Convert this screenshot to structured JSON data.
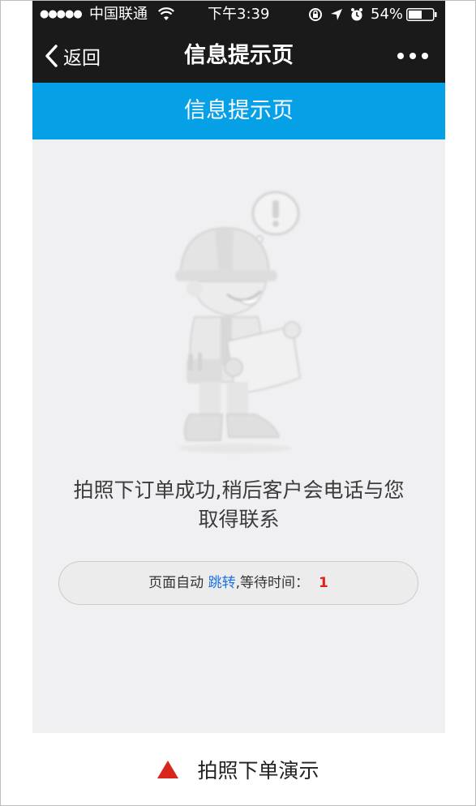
{
  "status_bar": {
    "signal": "●●●●●",
    "carrier": "中国联通",
    "time": "下午3:39",
    "battery": "54%",
    "icons": [
      "signal-dots-icon",
      "wifi-icon",
      "orientation-lock-icon",
      "location-arrow-icon",
      "alarm-icon",
      "battery-icon"
    ]
  },
  "nav": {
    "back_label": "返回",
    "title": "信息提示页",
    "more_icon": "more-dots-icon"
  },
  "header": {
    "title": "信息提示页"
  },
  "main": {
    "illustration_icon": "worker-with-blueprint-icon",
    "message_line1": "拍照下订单成功,稍后客户会电话与您",
    "message_line2": "取得联系",
    "redirect": {
      "prefix": "页面自动 ",
      "link_text": "跳转",
      "suffix": ",等待时间：",
      "countdown": "1"
    }
  },
  "caption": {
    "text": "拍照下单演示",
    "icon": "red-triangle-icon"
  },
  "colors": {
    "status_bar_bg": "#1a1a1a",
    "header_bg": "#06a0e6",
    "content_bg": "#f0f0f2",
    "link": "#1a73e8",
    "countdown": "#e02020",
    "caption_triangle": "#d9261c"
  }
}
